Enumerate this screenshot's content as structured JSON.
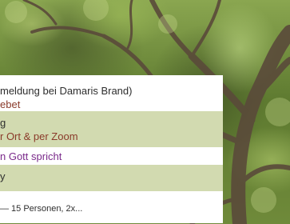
{
  "background": {
    "image": "forest-trees"
  },
  "list": {
    "items": [
      {
        "line1": "meldung bei Damaris Brand)",
        "line2": "ebet"
      },
      {
        "line1": "g",
        "line2": "r Ort & per Zoom"
      },
      {
        "line1": "n Gott spricht"
      },
      {
        "line1": "y"
      },
      {
        "line1": "— 15 Personen, 2x..."
      }
    ]
  },
  "colors": {
    "row_white": "#ffffff",
    "row_green": "#d2dab0",
    "accent_red": "#8a3a2a",
    "accent_purple": "#7a2a8a"
  }
}
